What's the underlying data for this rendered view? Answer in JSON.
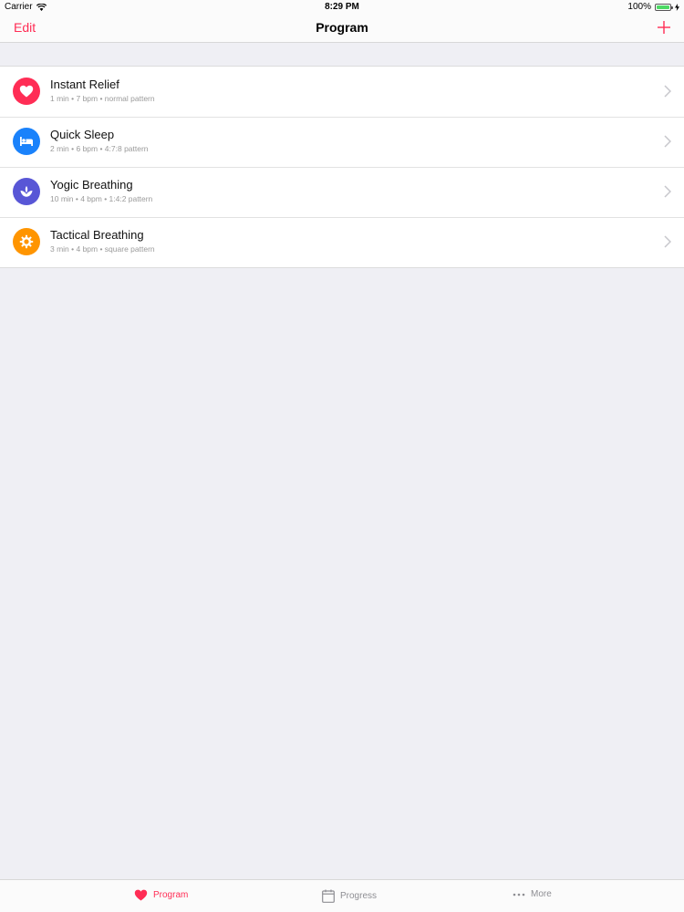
{
  "status_bar": {
    "carrier": "Carrier",
    "time": "8:29 PM",
    "battery": "100%",
    "battery_level": 1.0
  },
  "nav": {
    "edit_label": "Edit",
    "title": "Program",
    "add_icon": "plus-icon"
  },
  "programs": [
    {
      "title": "Instant Relief",
      "subtitle": "1 min • 7 bpm • normal pattern",
      "icon": "heart-icon",
      "color": "#ff2d55"
    },
    {
      "title": "Quick Sleep",
      "subtitle": "2 min • 6 bpm • 4:7:8 pattern",
      "icon": "bed-icon",
      "color": "#1a82fb"
    },
    {
      "title": "Yogic Breathing",
      "subtitle": "10 min • 4 bpm • 1:4:2 pattern",
      "icon": "lotus-icon",
      "color": "#5856d6"
    },
    {
      "title": "Tactical Breathing",
      "subtitle": "3 min • 4 bpm • square pattern",
      "icon": "gear-icon",
      "color": "#ff9500"
    }
  ],
  "tabs": [
    {
      "label": "Program",
      "icon": "heart-icon",
      "active": true
    },
    {
      "label": "Progress",
      "icon": "calendar-icon",
      "active": false
    },
    {
      "label": "More",
      "icon": "more-icon",
      "active": false
    }
  ],
  "colors": {
    "accent": "#ff2d55",
    "background": "#efeff4",
    "inactive_tab": "#8e8e93"
  }
}
